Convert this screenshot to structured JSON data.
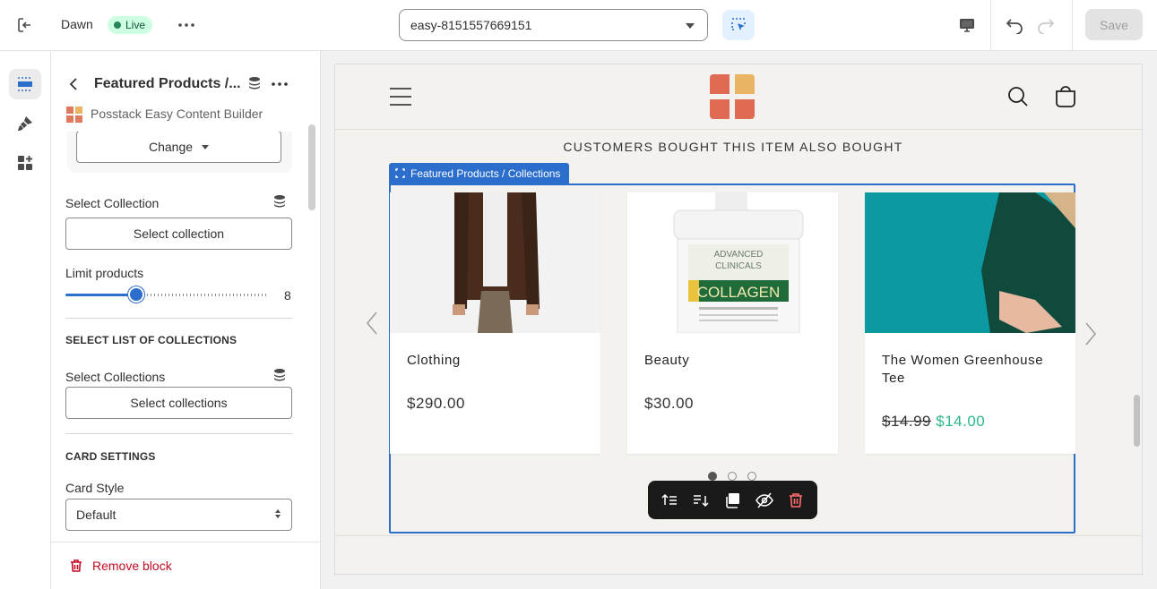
{
  "topbar": {
    "theme_name": "Dawn",
    "live_badge": "Live",
    "template_value": "easy-8151557669151",
    "save_label": "Save"
  },
  "panel": {
    "title": "Featured Products /...",
    "app_name": "Posstack Easy Content Builder",
    "change_label": "Change",
    "select_collection_label": "Select Collection",
    "select_collection_button": "Select collection",
    "limit_label": "Limit products",
    "limit_value": "8",
    "limit_fraction": 0.35,
    "list_section_heading": "SELECT LIST OF COLLECTIONS",
    "select_collections_label": "Select Collections",
    "select_collections_button": "Select collections",
    "card_section_heading": "CARD SETTINGS",
    "card_style_label": "Card Style",
    "card_style_value": "Default",
    "remove_label": "Remove block"
  },
  "preview": {
    "section_heading": "CUSTOMERS BOUGHT THIS ITEM ALSO BOUGHT",
    "selection_tag": "Featured Products / Collections",
    "products": [
      {
        "title": "Clothing",
        "price": "$290.00"
      },
      {
        "title": "Beauty",
        "price": "$30.00"
      },
      {
        "title": "The Women Greenhouse Tee",
        "compare_price": "$14.99",
        "sale_price": "$14.00"
      }
    ],
    "carousel_page": 1,
    "carousel_pages": 3
  },
  "colors": {
    "accent": "#2c6ecb",
    "live_bg": "#cdfee1",
    "sale": "#2bb789",
    "danger": "#c70a24"
  }
}
